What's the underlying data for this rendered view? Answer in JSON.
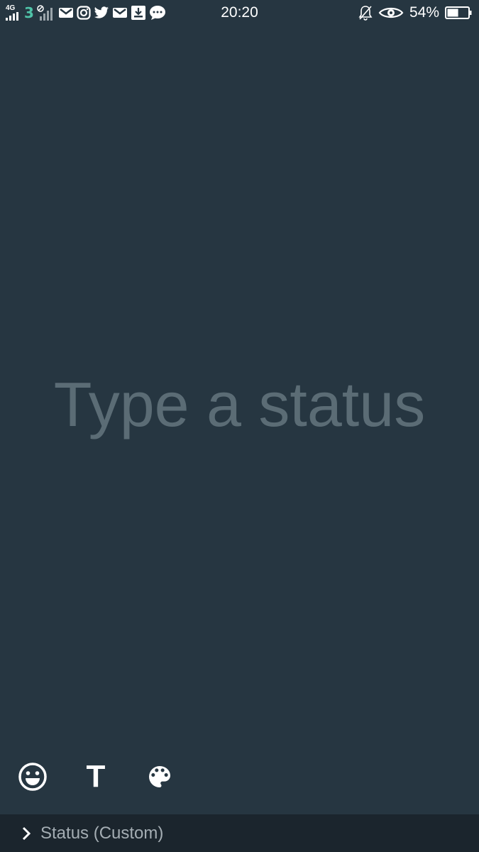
{
  "status_bar": {
    "network_type": "4G",
    "carrier_icon": "3",
    "time": "20:20",
    "battery_percent": "54%",
    "battery_level": 0.54,
    "left_icons": [
      "signal-icon",
      "carrier-3-icon",
      "signal-2-icon",
      "gmail-icon",
      "instagram-icon",
      "twitter-icon",
      "gmail-icon",
      "download-icon",
      "messages-icon"
    ],
    "right_icons": [
      "mute-bell-icon",
      "eye-icon",
      "battery-icon"
    ]
  },
  "composer": {
    "placeholder": "Type a status",
    "value": ""
  },
  "toolbar": {
    "emoji_icon": "emoji-icon",
    "text_label": "T",
    "palette_icon": "palette-icon"
  },
  "bottom_bar": {
    "label": "Status (Custom)"
  },
  "colors": {
    "background": "#263641",
    "placeholder": "#5b6c75",
    "bottom_bar": "#1b252d",
    "bottom_text": "#a4adb3"
  }
}
